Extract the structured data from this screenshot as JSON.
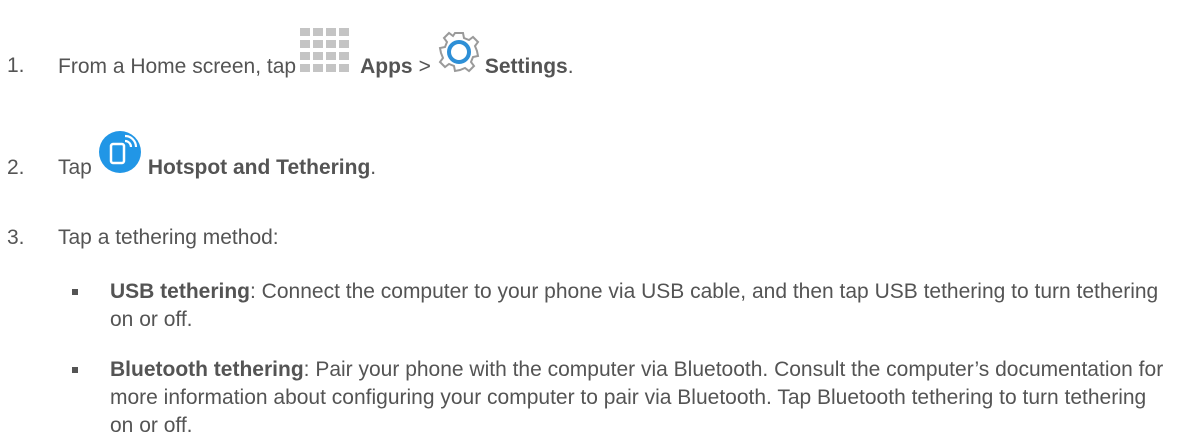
{
  "steps": [
    {
      "number": "1.",
      "lead": "From a Home screen, tap",
      "bold1": "Apps",
      "sep": ">",
      "bold2": "Settings",
      "end": ".",
      "icons": [
        "apps-grid-icon",
        "settings-gear-icon"
      ]
    },
    {
      "number": "2.",
      "lead": "Tap",
      "bold1": "Hotspot and Tethering",
      "end": ".",
      "icons": [
        "hotspot-tethering-icon"
      ]
    },
    {
      "number": "3.",
      "lead": "Tap a tethering method:"
    }
  ],
  "bullets": [
    {
      "term": "USB tethering",
      "text": ": Connect the computer to your phone via USB cable, and then tap USB tethering to turn tethering on or off."
    },
    {
      "term": "Bluetooth tethering",
      "text": ": Pair your phone with the computer via Bluetooth. Consult the computer’s documentation for more information about configuring your computer to pair via Bluetooth. Tap Bluetooth tethering to turn tethering on or off."
    }
  ],
  "colors": {
    "text": "#545454",
    "hotspot_icon": "#1e88e5",
    "apps_grid": "#b0b0b0",
    "gear": "#4fb3e8"
  }
}
